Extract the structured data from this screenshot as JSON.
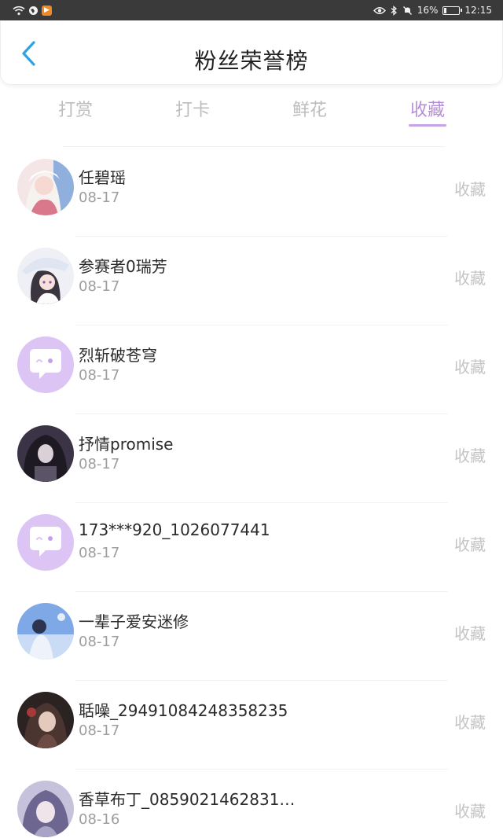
{
  "status_bar": {
    "battery": "16%",
    "time": "12:15",
    "battery_level": 0.16
  },
  "header": {
    "title": "粉丝荣誉榜"
  },
  "tabs": [
    {
      "label": "打赏"
    },
    {
      "label": "打卡"
    },
    {
      "label": "鲜花"
    },
    {
      "label": "收藏"
    }
  ],
  "active_tab": "收藏",
  "colors": {
    "accent": "#b58fd6",
    "back_arrow": "#2ea3e3",
    "default_avatar_bg": "#d8c2f3"
  },
  "list": [
    {
      "name": "任碧瑶",
      "date": "08-17",
      "action": "收藏",
      "avatar": "anime-girl-pink"
    },
    {
      "name": "参赛者0瑞芳",
      "date": "08-17",
      "action": "收藏",
      "avatar": "anime-girl-hat"
    },
    {
      "name": "烈斩破苍穹",
      "date": "08-17",
      "action": "收藏",
      "avatar": "default-chat-avatar"
    },
    {
      "name": "抒情promise",
      "date": "08-17",
      "action": "收藏",
      "avatar": "dark-anime-girl"
    },
    {
      "name": "173***920_1026077441",
      "date": "08-17",
      "action": "收藏",
      "avatar": "default-chat-avatar"
    },
    {
      "name": "一辈子爱安迷修",
      "date": "08-17",
      "action": "收藏",
      "avatar": "blue-sky-figure"
    },
    {
      "name": "聒噪_29491084248358235",
      "date": "08-17",
      "action": "收藏",
      "avatar": "dark-portrait"
    },
    {
      "name": "香草布丁_0859021462831…",
      "date": "08-16",
      "action": "收藏",
      "avatar": "purple-anime-girl"
    }
  ]
}
